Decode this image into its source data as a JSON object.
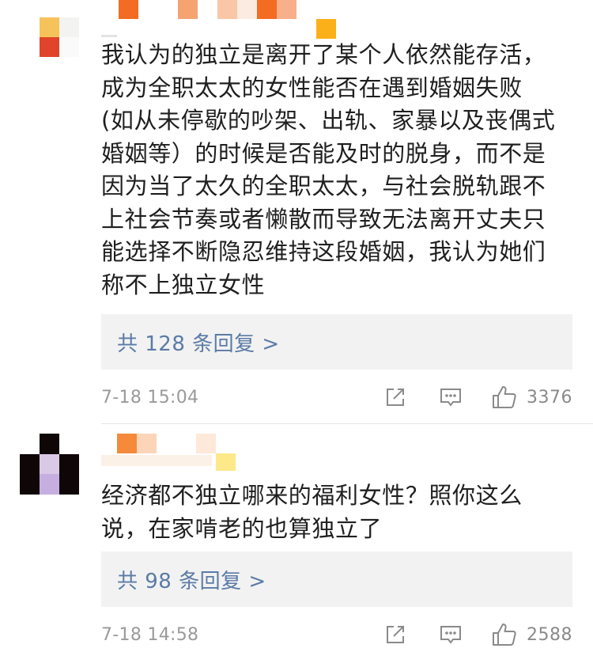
{
  "colors": {
    "link": "#5b7ba6",
    "reply_bg": "#f2f2f2",
    "meta_text": "#9a9a9a",
    "body_text": "#1f1f1f"
  },
  "comments": [
    {
      "text": "我认为的独立是离开了某个人依然能存活，\n成为全职太太的女性能否在遇到婚姻失败\n(如从未停歇的吵架、出轨、家暴以及丧偶式\n婚姻等）的时候是否能及时的脱身，而不是\n因为当了太久的全职太太，与社会脱轨跟不\n上社会节奏或者懒散而导致无法离开丈夫只\n能选择不断隐忍维持这段婚姻，我认为她们\n称不上独立女性",
      "reply_link": "共 128 条回复 >",
      "timestamp": "7-18 15:04",
      "like_count": "3376",
      "icons": [
        "share-icon",
        "comment-icon",
        "thumbs-up-icon"
      ]
    },
    {
      "text": "经济都不独立哪来的福利女性？照你这么\n说，在家啃老的也算独立了",
      "reply_link": "共 98 条回复 >",
      "timestamp": "7-18 14:58",
      "like_count": "2588",
      "icons": [
        "share-icon",
        "comment-icon",
        "thumbs-up-icon"
      ]
    }
  ]
}
